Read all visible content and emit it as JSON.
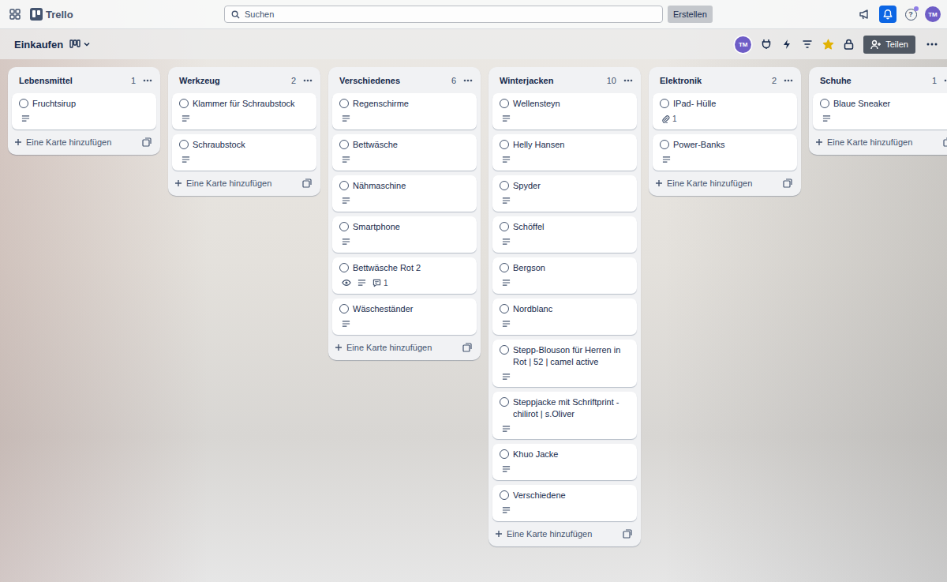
{
  "topbar": {
    "logo": "Trello",
    "search_placeholder": "Suchen",
    "create_button": "Erstellen",
    "notifications_active": true,
    "help_icon": "?",
    "help_badge": true,
    "avatar": "TM"
  },
  "board": {
    "title": "Einkaufen",
    "member_avatar": "TM",
    "starred": true,
    "share_button": "Teilen"
  },
  "add_card_label": "Eine Karte hinzufügen",
  "lists": [
    {
      "title": "Lebensmittel",
      "count": "1",
      "cards": [
        {
          "title": "Fruchtsirup",
          "completed": false,
          "description": true,
          "watching": false
        }
      ]
    },
    {
      "title": "Werkzeug",
      "count": "2",
      "cards": [
        {
          "title": "Klammer für Schraubstock",
          "completed": false,
          "description": true,
          "watching": false
        },
        {
          "title": "Schraubstock",
          "completed": false,
          "description": true,
          "watching": false
        }
      ]
    },
    {
      "title": "Verschiedenes",
      "count": "6",
      "cards": [
        {
          "title": "Regenschirme",
          "completed": false,
          "description": true,
          "watching": false
        },
        {
          "title": "Bettwäsche",
          "completed": false,
          "description": true,
          "watching": false
        },
        {
          "title": "Nähmaschine",
          "completed": false,
          "description": true,
          "watching": false
        },
        {
          "title": "Smartphone",
          "completed": false,
          "description": true,
          "watching": false
        },
        {
          "title": "Bettwäsche Rot 2",
          "completed": false,
          "description": true,
          "watching": true,
          "comments": "1"
        },
        {
          "title": "Wäscheständer",
          "completed": false,
          "description": true,
          "watching": false
        }
      ]
    },
    {
      "title": "Winterjacken",
      "count": "10",
      "cards": [
        {
          "title": "Wellensteyn",
          "completed": false,
          "description": true,
          "watching": false
        },
        {
          "title": "Helly Hansen",
          "completed": false,
          "description": true,
          "watching": false
        },
        {
          "title": "Spyder",
          "completed": false,
          "description": true,
          "watching": false
        },
        {
          "title": "Schöffel",
          "completed": false,
          "description": true,
          "watching": false
        },
        {
          "title": "Bergson",
          "completed": false,
          "description": true,
          "watching": false
        },
        {
          "title": "Nordblanc",
          "completed": false,
          "description": true,
          "watching": false
        },
        {
          "title": "Stepp-Blouson für Herren in Rot | 52 | camel active",
          "completed": false,
          "description": true,
          "watching": false
        },
        {
          "title": "Steppjacke mit Schriftprint - chilirot | s.Oliver",
          "completed": false,
          "description": true,
          "watching": false
        },
        {
          "title": "Khuo Jacke",
          "completed": false,
          "description": true,
          "watching": false
        },
        {
          "title": "Verschiedene",
          "completed": false,
          "description": true,
          "watching": false
        }
      ]
    },
    {
      "title": "Elektronik",
      "count": "2",
      "cards": [
        {
          "title": "IPad- Hülle",
          "completed": false,
          "description": false,
          "watching": false,
          "attachments": "1"
        },
        {
          "title": "Power-Banks",
          "completed": false,
          "description": true,
          "watching": false
        }
      ]
    },
    {
      "title": "Schuhe",
      "count": "1",
      "cards": [
        {
          "title": "Blaue Sneaker",
          "completed": false,
          "description": true,
          "watching": false
        }
      ]
    }
  ]
}
